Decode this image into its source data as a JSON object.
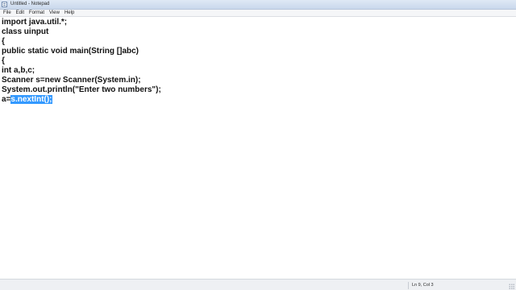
{
  "window": {
    "title": "Untitled - Notepad"
  },
  "menu": {
    "items": [
      "File",
      "Edit",
      "Format",
      "View",
      "Help"
    ]
  },
  "editor": {
    "lines": [
      "import java.util.*;",
      "class uinput",
      "{",
      "public static void main(String []abc)",
      "{",
      "int a,b,c;",
      "Scanner s=new Scanner(System.in);",
      "System.out.println(\"Enter two numbers\");"
    ],
    "last_line_prefix": "a=",
    "selected_text": "s.nextInt();"
  },
  "status": {
    "position": "Ln 9, Col 3"
  },
  "colors": {
    "selection": "#3399ff",
    "titlebar": "#dfe9f5"
  },
  "icons": {
    "app": "notepad-icon",
    "resize": "resize-grip-icon"
  }
}
